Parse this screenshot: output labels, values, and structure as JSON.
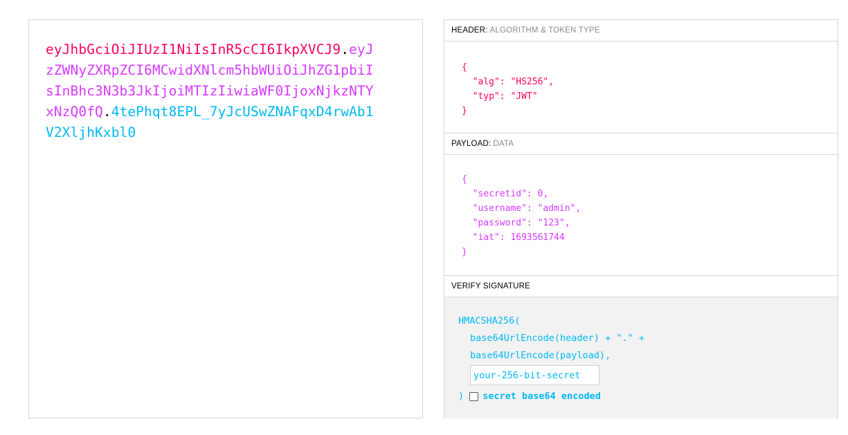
{
  "encoded": {
    "header": "eyJhbGciOiJIUzI1NiIsInR5cCI6IkpXVCJ9",
    "payload": "eyJzZWNyZXRpZCI6MCwidXNlcm5hbWUiOiJhZG1pbiIsInBhc3N3b3JkIjoiMTIzIiwiaWF0IjoxNjkzNTYxNzQ0fQ",
    "signature": "4tePhqt8EPL_7yJcUSwZNAFqxD4rwAb1V2XljhKxbl0",
    "dot": "."
  },
  "header_section": {
    "title": "HEADER:",
    "subtitle": "ALGORITHM & TOKEN TYPE",
    "lines": [
      "{",
      "  \"alg\": \"HS256\",",
      "  \"typ\": \"JWT\"",
      "}"
    ]
  },
  "payload_section": {
    "title": "PAYLOAD:",
    "subtitle": "DATA",
    "lines": [
      "{",
      "  \"secretid\": 0,",
      "  \"username\": \"admin\",",
      "  \"password\": \"123\",",
      "  \"iat\": 1693561744",
      "}"
    ]
  },
  "verify_section": {
    "title": "VERIFY SIGNATURE",
    "func_open": "HMACSHA256(",
    "arg1": "base64UrlEncode(header) + \".\" +",
    "arg2": "base64UrlEncode(payload),",
    "secret_placeholder": "your-256-bit-secret",
    "secret_value": "",
    "func_close": ")",
    "checkbox_label": "secret base64 encoded",
    "checkbox_checked": false
  },
  "colors": {
    "header": "#fb015b",
    "payload": "#d63aff",
    "signature": "#00b9f1"
  }
}
